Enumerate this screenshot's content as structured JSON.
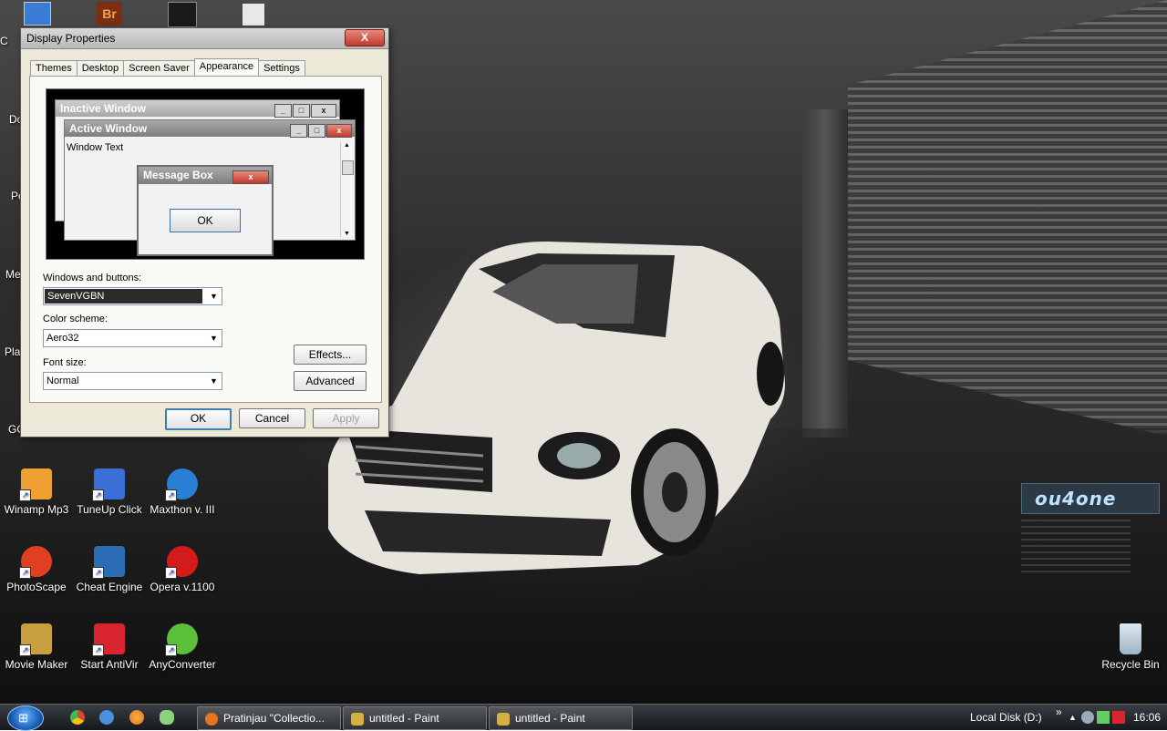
{
  "dialog": {
    "title": "Display Properties",
    "close_glyph": "X",
    "tabs": [
      {
        "label": "Themes"
      },
      {
        "label": "Desktop"
      },
      {
        "label": "Screen Saver"
      },
      {
        "label": "Appearance"
      },
      {
        "label": "Settings"
      }
    ],
    "active_tab": "Appearance",
    "preview": {
      "inactive_title": "Inactive Window",
      "active_title": "Active Window",
      "window_text": "Window Text",
      "message_title": "Message Box",
      "message_ok": "OK"
    },
    "windows_buttons_label": "Windows and buttons:",
    "windows_buttons_value": "SevenVGBN",
    "color_scheme_label": "Color scheme:",
    "color_scheme_value": "Aero32",
    "font_size_label": "Font size:",
    "font_size_value": "Normal",
    "effects_label": "Effects...",
    "advanced_label": "Advanced",
    "ok_label": "OK",
    "cancel_label": "Cancel",
    "apply_label": "Apply"
  },
  "desktop": {
    "partial_labels": [
      "C",
      "Do",
      "Pe",
      "Me",
      "Pla",
      "GO"
    ],
    "icons": [
      {
        "label": "Winamp Mp3",
        "icon": "winamp-icon",
        "color": "#f0a030"
      },
      {
        "label": "TuneUp Click",
        "icon": "tuneup-icon",
        "color": "#3a6fd8"
      },
      {
        "label": "Maxthon v. III",
        "icon": "maxthon-icon",
        "color": "#2a7fd4"
      },
      {
        "label": "PhotoScape",
        "icon": "photoscape-icon",
        "color": "#e04020"
      },
      {
        "label": "Cheat Engine",
        "icon": "cheat-engine-icon",
        "color": "#2a6db5"
      },
      {
        "label": "Opera v.1100",
        "icon": "opera-icon",
        "color": "#d41b1b"
      },
      {
        "label": "Movie Maker",
        "icon": "movie-maker-icon",
        "color": "#c8a040"
      },
      {
        "label": "Start AntiVir",
        "icon": "antivir-icon",
        "color": "#d9262e"
      },
      {
        "label": "AnyConverter",
        "icon": "anyconverter-icon",
        "color": "#5bbf3a"
      },
      {
        "label": "Recycle Bin",
        "icon": "recycle-bin-icon",
        "color": "#b8c9d8"
      }
    ],
    "brand_text": "ou4one"
  },
  "taskbar": {
    "tasks": [
      {
        "label": "Pratinjau \"Collectio...",
        "icon": "firefox-icon",
        "color": "#e8741c"
      },
      {
        "label": "untitled - Paint",
        "icon": "paint-icon",
        "color": "#d8b040"
      },
      {
        "label": "untitled - Paint",
        "icon": "paint-icon",
        "color": "#d8b040"
      }
    ],
    "quick_launch": [
      {
        "icon": "chrome-icon",
        "color": "#3cba54"
      },
      {
        "icon": "messenger-icon",
        "color": "#4a8fe0"
      },
      {
        "icon": "firefox-icon",
        "color": "#e8741c"
      },
      {
        "icon": "chat-icon",
        "color": "#8fd07a"
      }
    ],
    "toolbar_label": "Local Disk (D:)",
    "expand_glyph": "»",
    "clock": "16:06"
  }
}
